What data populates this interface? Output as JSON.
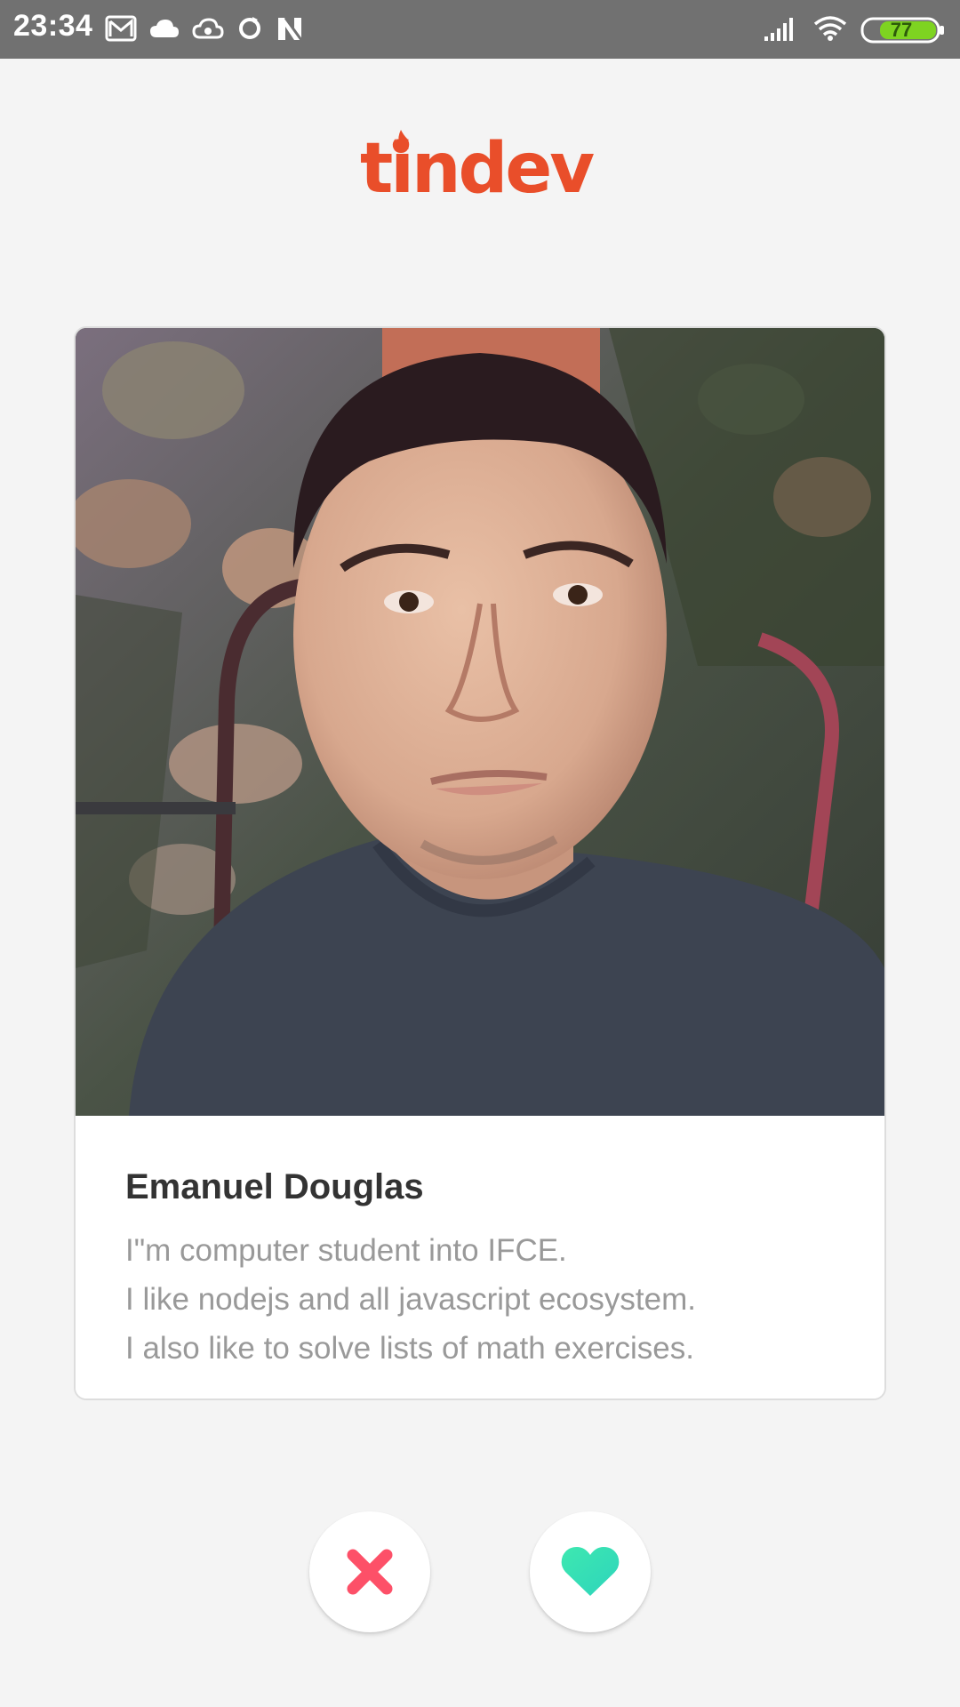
{
  "status_bar": {
    "time": "23:34",
    "battery_level": "77",
    "left_icons": [
      "gmail-icon",
      "cloud-icon",
      "cloud-sync-icon",
      "sync-icon",
      "n-icon"
    ],
    "right_icons": [
      "signal-icon",
      "wifi-icon",
      "battery-icon"
    ]
  },
  "header": {
    "logo_text": "tindev",
    "logo_color": "#e94e2a"
  },
  "profile": {
    "name": "Emanuel Douglas",
    "bio_lines": [
      "I\"m computer student into IFCE.",
      "I like nodejs and all javascript ecosystem.",
      "I also like to solve lists of math exercises."
    ]
  },
  "actions": {
    "dislike_icon": "close-icon",
    "dislike_color": "#fd5068",
    "like_icon": "heart-icon",
    "like_color": "#35e0b4"
  }
}
